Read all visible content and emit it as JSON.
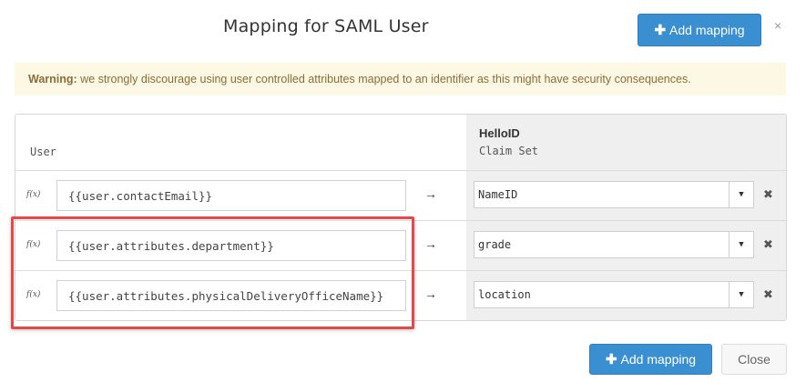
{
  "modal": {
    "title": "Mapping for SAML User",
    "close_glyph": "×"
  },
  "buttons": {
    "add_mapping_plus": "✚",
    "add_mapping_label": "Add mapping",
    "close_label": "Close"
  },
  "warning": {
    "strong": "Warning:",
    "text": " we strongly discourage using user controlled attributes mapped to an identifier as this might have security consequences."
  },
  "table": {
    "left_header": "User",
    "right_header_title": "HelloID",
    "right_header_sub": "Claim Set",
    "rows": [
      {
        "fx": "f(x)",
        "expression": "{{user.contactEmail}}",
        "arrow": "→",
        "claim": "NameID",
        "caret": "▼",
        "delete": "✖"
      },
      {
        "fx": "f(x)",
        "expression": "{{user.attributes.department}}",
        "arrow": "→",
        "claim": "grade",
        "caret": "▼",
        "delete": "✖"
      },
      {
        "fx": "f(x)",
        "expression": "{{user.attributes.physicalDeliveryOfficeName}}",
        "arrow": "→",
        "claim": "location",
        "caret": "▼",
        "delete": "✖"
      }
    ]
  },
  "colors": {
    "primary": "#3a8fd1",
    "warning_bg": "#fcf8e3",
    "warning_text": "#8a6d3b",
    "highlight": "#e8474a"
  },
  "icons": {
    "add": "plus-icon",
    "close": "close-icon",
    "arrow": "arrow-right-icon",
    "caret": "caret-down-icon",
    "delete": "delete-icon",
    "function": "function-icon"
  }
}
